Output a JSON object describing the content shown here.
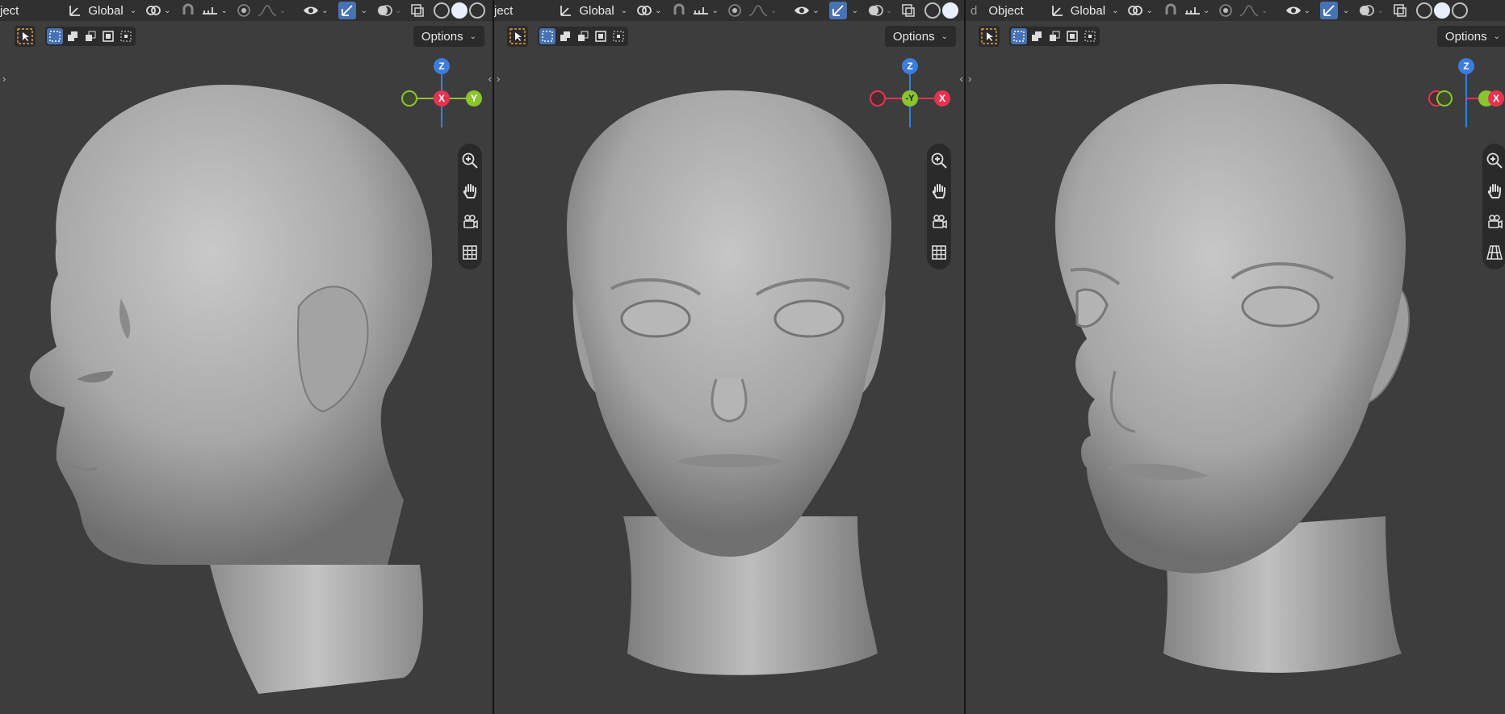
{
  "header": {
    "mode_labels": [
      "ject",
      "ject",
      "Object"
    ],
    "orientation_label": "Global",
    "options_label": "Options"
  },
  "gizmo": {
    "z": "Z",
    "left": {
      "x_label": "X",
      "y_label": "Y"
    },
    "middle": {
      "x_label": "X",
      "y_label": "-Y"
    },
    "right": {
      "x_label": "X"
    }
  },
  "colors": {
    "axis_x": "#e8334f",
    "axis_y": "#8ac52f",
    "axis_z": "#3b7ddb",
    "accent": "#4772b3",
    "viewport_bg": "#3d3d3d",
    "header_bg": "#303030"
  },
  "icons": {
    "orientation": "transform-orientation-icon",
    "pivot": "pivot-point-icon",
    "snap": "snap-magnet-icon",
    "proportional": "proportional-editing-icon",
    "visibility": "object-visibility-icon",
    "gizmo": "gizmo-icon",
    "overlay": "overlay-icon",
    "xray": "xray-icon",
    "zoom": "zoom-icon",
    "pan": "hand-pan-icon",
    "camera": "camera-view-icon",
    "grid": "orthographic-grid-icon",
    "select": "select-cursor-icon"
  }
}
